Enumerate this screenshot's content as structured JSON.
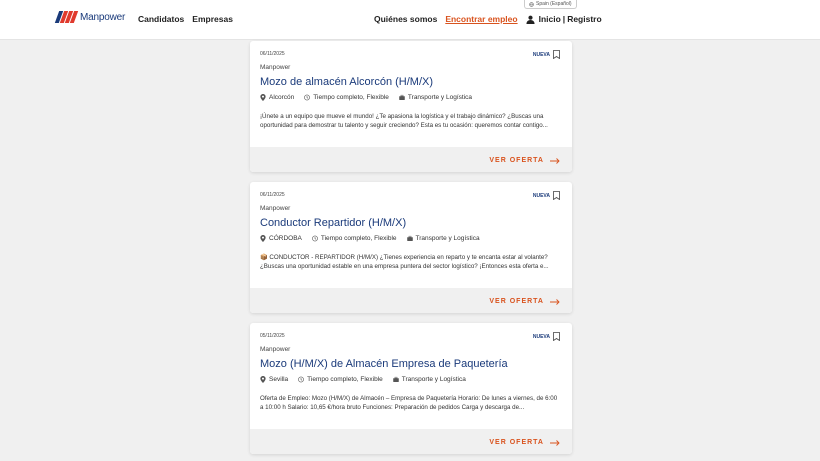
{
  "header": {
    "brand": "Manpower",
    "nav_left": [
      "Candidatos",
      "Empresas"
    ],
    "language": "Spain (Español)",
    "nav_right": {
      "about": "Quiénes somos",
      "jobs": "Encontrar empleo",
      "login": "Inicio",
      "separator": "|",
      "register": "Registro"
    },
    "accent_color": "#d9531e",
    "brand_color": "#1a3a7a"
  },
  "jobs": [
    {
      "date": "06/11/2025",
      "company": "Manpower",
      "title": "Mozo de almacén Alcorcón (H/M/X)",
      "badge": "NUEVA",
      "location": "Alcorcón",
      "schedule": "Tiempo completo, Flexible",
      "sector": "Transporte y Logística",
      "description": "¡Únete a un equipo que mueve el mundo! ¿Te apasiona la logística y el trabajo dinámico? ¿Buscas una oportunidad para demostrar tu talento y seguir creciendo? Esta es tu ocasión: queremos contar contigo...",
      "cta": "VER OFERTA"
    },
    {
      "date": "06/11/2025",
      "company": "Manpower",
      "title": "Conductor Repartidor (H/M/X)",
      "badge": "NUEVA",
      "location": "CÓRDOBA",
      "schedule": "Tiempo completo, Flexible",
      "sector": "Transporte y Logística",
      "description": "📦 CONDUCTOR - REPARTIDOR (H/M/X) ¿Tienes experiencia en reparto y te encanta estar al volante? ¿Buscas una oportunidad estable en una empresa puntera del sector logístico? ¡Entonces esta oferta e...",
      "cta": "VER OFERTA"
    },
    {
      "date": "05/11/2025",
      "company": "Manpower",
      "title": "Mozo (H/M/X) de Almacén Empresa de Paquetería",
      "badge": "NUEVA",
      "location": "Sevilla",
      "schedule": "Tiempo completo, Flexible",
      "sector": "Transporte y Logística",
      "description": "Oferta de Empleo: Mozo (H/M/X) de Almacén – Empresa de Paquetería Horario: De lunes a viernes, de 6:00 a 10:00 h Salario: 10,65 €/hora bruto Funciones: Preparación de pedidos Carga y descarga de...",
      "cta": "VER OFERTA"
    }
  ]
}
